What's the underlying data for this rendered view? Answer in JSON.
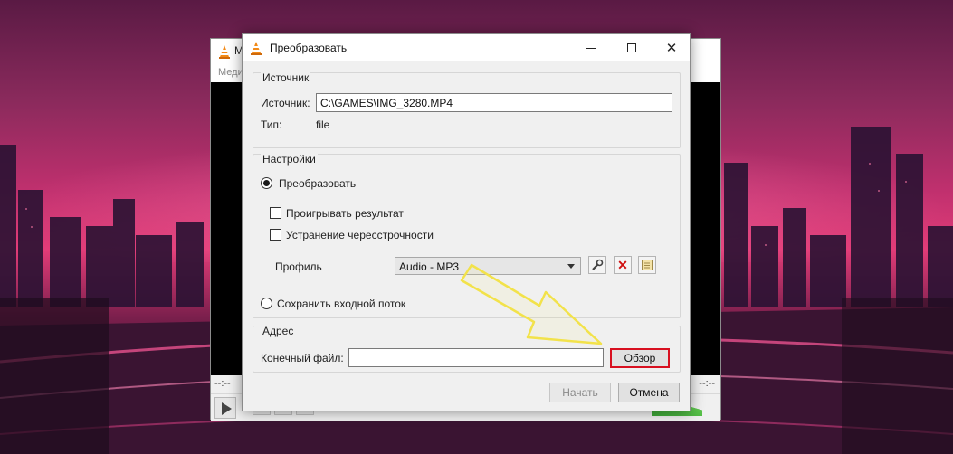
{
  "background_window": {
    "title_letter": "M",
    "menu_text": "Меди",
    "time_left": "--:--",
    "time_right": "--:--"
  },
  "dialog": {
    "title": "Преобразовать",
    "source_group": {
      "title": "Источник",
      "source_label": "Источник:",
      "source_value": "C:\\GAMES\\IMG_3280.MP4",
      "type_label": "Тип:",
      "type_value": "file"
    },
    "settings_group": {
      "title": "Настройки",
      "convert_label": "Преобразовать",
      "convert_selected": true,
      "play_result_label": "Проигрывать результат",
      "deinterlace_label": "Устранение чересстрочности",
      "profile_label": "Профиль",
      "profile_value": "Audio - MP3",
      "save_stream_label": "Сохранить входной поток"
    },
    "address_group": {
      "title": "Адрес",
      "dest_label": "Конечный файл:",
      "dest_value": "",
      "browse_label": "Обзор"
    },
    "start_label": "Начать",
    "cancel_label": "Отмена"
  },
  "colors": {
    "highlight_box": "#d81020",
    "arrow": "#f2e24a",
    "delete_icon": "#d01010"
  },
  "icons": [
    "vlc-cone-icon",
    "minimize-icon",
    "maximize-icon",
    "close-icon",
    "wrench-icon",
    "delete-icon",
    "new-profile-icon",
    "dropdown-arrow-icon"
  ]
}
